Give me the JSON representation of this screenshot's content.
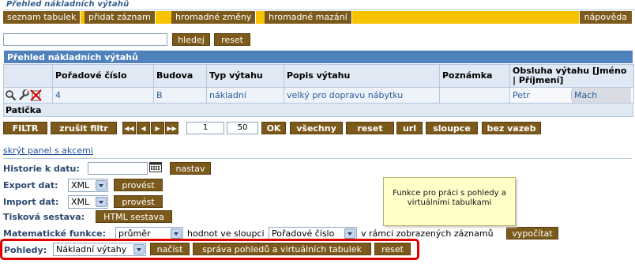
{
  "page": {
    "title": "Přehled nákladních výtahů"
  },
  "menu": {
    "items": [
      "seznam tabulek",
      "přidat záznam",
      "hromadné změny",
      "hromadné mazání"
    ],
    "help": "nápověda",
    "color_bar": "#f8c300",
    "color_button": "#7c5a1c"
  },
  "search": {
    "value": "",
    "search_label": "hledej",
    "reset_label": "reset"
  },
  "table": {
    "caption": "Přehled nákladních výtahů",
    "headers": {
      "number": "Pořadové číslo",
      "building": "Budova",
      "type": "Typ výtahu",
      "description": "Popis výtahu",
      "note": "Poznámka",
      "service": "Obsluha výtahu [Jméno | Příjmení]"
    },
    "rows": [
      {
        "number": "4",
        "building": "B",
        "type": "nákladní",
        "description": "velký pro dopravu nábytku",
        "note": "",
        "first_name": "Petr",
        "last_name": "Mach"
      }
    ],
    "row_icons": [
      "magnifier-icon",
      "wrench-icon",
      "delete-icon"
    ],
    "footer": "Patička"
  },
  "toolbar": {
    "filter": "FILTR",
    "clear_filter": "zrušit filtr",
    "nav_icons": [
      "first-page-icon",
      "previous-page-icon",
      "next-page-icon",
      "last-page-icon"
    ],
    "page": "1",
    "per_page": "50",
    "ok": "OK",
    "all": "všechny",
    "reset": "reset",
    "url": "url",
    "columns": "sloupce",
    "no_links": "bez vazeb"
  },
  "actions": {
    "hide_panel": "skrýt panel s akcemi",
    "history_label": "Historie k datu:",
    "history_value": "",
    "history_button": "nastav",
    "export_label": "Export dat:",
    "export_format": "XML",
    "export_button": "provést",
    "import_label": "Import dat:",
    "import_format": "XML",
    "import_button": "provést",
    "print_label": "Tisková sestava:",
    "print_button": "HTML sestava",
    "math_label": "Matematické funkce:",
    "math_function": "průměr",
    "math_text1": "hodnot ve sloupci",
    "math_column": "Pořadové číslo",
    "math_text2": "v rámci zobrazených záznamů",
    "math_button": "vypočítat",
    "views_label": "Pohledy:",
    "views_value": "Nákladní výtahy",
    "load_button": "načíst",
    "manage_button": "správa pohledů a virtuálních tabulek",
    "views_reset": "reset"
  },
  "annotation": {
    "text": "Funkce pro práci s pohledy a virtuálními tabulkami",
    "highlight_color": "#e00000"
  }
}
